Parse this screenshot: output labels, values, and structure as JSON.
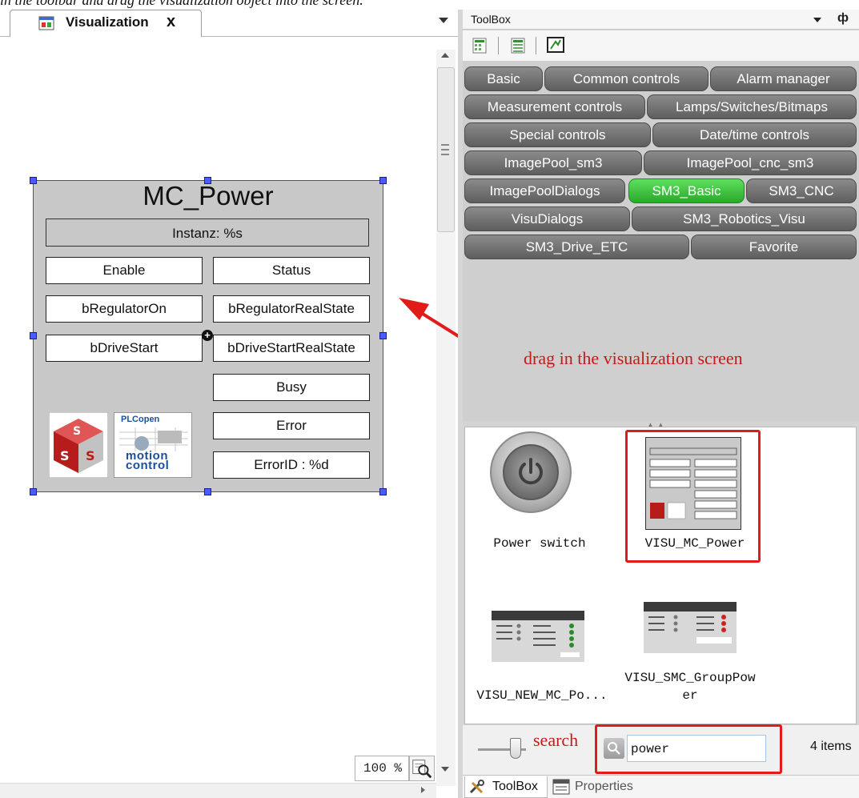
{
  "caption": "in the toolbar and drag the visualization object into the screen.",
  "editor": {
    "tab_title": "Visualization",
    "tab_close": "x",
    "zoom": "100 %",
    "element": {
      "title": "MC_Power",
      "instance": "Instanz: %s",
      "left_fields": [
        "Enable",
        "bRegulatorOn",
        "bDriveStart"
      ],
      "right_fields": [
        "Status",
        "bRegulatorRealState",
        "bDriveStartRealState",
        "Busy",
        "Error",
        "ErrorID : %d"
      ],
      "logo_top": "PLCopen",
      "logo_bottom_1": "motion",
      "logo_bottom_2": "control"
    }
  },
  "toolbox": {
    "title": "ToolBox",
    "pin": "ф",
    "categories": [
      [
        "Basic",
        "Common controls",
        "Alarm manager"
      ],
      [
        "Measurement controls",
        "Lamps/Switches/Bitmaps"
      ],
      [
        "Special controls",
        "Date/time controls"
      ],
      [
        "ImagePool_sm3",
        "ImagePool_cnc_sm3"
      ],
      [
        "ImagePoolDialogs",
        "SM3_Basic",
        "SM3_CNC"
      ],
      [
        "VisuDialogs",
        "SM3_Robotics_Visu"
      ],
      [
        "SM3_Drive_ETC",
        "Favorite"
      ]
    ],
    "active_category": "SM3_Basic",
    "items": [
      "Power switch",
      "VISU_MC_Power",
      "VISU_NEW_MC_Po...",
      "VISU_SMC_GroupPow",
      "er"
    ],
    "search_value": "power",
    "items_count": "4 items",
    "bottom_tabs": [
      "ToolBox",
      "Properties"
    ]
  },
  "annotations": {
    "drag_hint": "drag in the visualization screen",
    "search_hint": "search"
  },
  "colors": {
    "category_bg": "#6f6f6f",
    "category_active_bg": "#3cc43c",
    "annotation_red": "#e21a1a",
    "selection_handle": "#4a5cff"
  }
}
